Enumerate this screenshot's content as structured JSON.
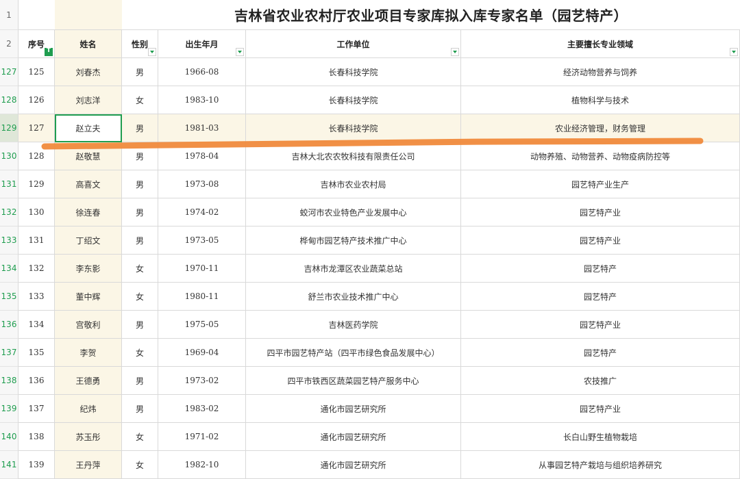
{
  "sheet_title": "吉林省农业农村厅农业项目专家库拟入库专家名单（园艺特产）",
  "row_numbers": {
    "title": "1",
    "header": "2"
  },
  "headers": {
    "seq": "序号",
    "name": "姓名",
    "gender": "性别",
    "birth": "出生年月",
    "employer": "工作单位",
    "expertise": "主要擅长专业领域"
  },
  "filter_active_glyph": "T",
  "rows": [
    {
      "row": "127",
      "seq": "125",
      "name": "刘春杰",
      "gender": "男",
      "birth": "1966-08",
      "employer": "长春科技学院",
      "expertise": "经济动物营养与饲养"
    },
    {
      "row": "128",
      "seq": "126",
      "name": "刘志洋",
      "gender": "女",
      "birth": "1983-10",
      "employer": "长春科技学院",
      "expertise": "植物科学与技术"
    },
    {
      "row": "129",
      "seq": "127",
      "name": "赵立夫",
      "gender": "男",
      "birth": "1981-03",
      "employer": "长春科技学院",
      "expertise": "农业经济管理，财务管理"
    },
    {
      "row": "130",
      "seq": "128",
      "name": "赵敬慧",
      "gender": "男",
      "birth": "1978-04",
      "employer": "吉林大北农农牧科技有限责任公司",
      "expertise": "动物养殖、动物营养、动物疫病防控等"
    },
    {
      "row": "131",
      "seq": "129",
      "name": "高喜文",
      "gender": "男",
      "birth": "1973-08",
      "employer": "吉林市农业农村局",
      "expertise": "园艺特产业生产"
    },
    {
      "row": "132",
      "seq": "130",
      "name": "徐连春",
      "gender": "男",
      "birth": "1974-02",
      "employer": "蛟河市农业特色产业发展中心",
      "expertise": "园艺特产业"
    },
    {
      "row": "133",
      "seq": "131",
      "name": "丁绍文",
      "gender": "男",
      "birth": "1973-05",
      "employer": "桦甸市园艺特产技术推广中心",
      "expertise": "园艺特产业"
    },
    {
      "row": "134",
      "seq": "132",
      "name": "李东影",
      "gender": "女",
      "birth": "1970-11",
      "employer": "吉林市龙潭区农业蔬菜总站",
      "expertise": "园艺特产"
    },
    {
      "row": "135",
      "seq": "133",
      "name": "董中辉",
      "gender": "女",
      "birth": "1980-11",
      "employer": "舒兰市农业技术推广中心",
      "expertise": "园艺特产"
    },
    {
      "row": "136",
      "seq": "134",
      "name": "宫敬利",
      "gender": "男",
      "birth": "1975-05",
      "employer": "吉林医药学院",
      "expertise": "园艺特产业"
    },
    {
      "row": "137",
      "seq": "135",
      "name": "李贺",
      "gender": "女",
      "birth": "1969-04",
      "employer": "四平市园艺特产站（四平市绿色食品发展中心）",
      "expertise": "园艺特产"
    },
    {
      "row": "138",
      "seq": "136",
      "name": "王德勇",
      "gender": "男",
      "birth": "1973-02",
      "employer": "四平市铁西区蔬菜园艺特产服务中心",
      "expertise": "农技推广"
    },
    {
      "row": "139",
      "seq": "137",
      "name": "纪炜",
      "gender": "男",
      "birth": "1983-02",
      "employer": "通化市园艺研究所",
      "expertise": "园艺特产业"
    },
    {
      "row": "140",
      "seq": "138",
      "name": "苏玉彤",
      "gender": "女",
      "birth": "1971-02",
      "employer": "通化市园艺研究所",
      "expertise": "长白山野生植物栽培"
    },
    {
      "row": "141",
      "seq": "139",
      "name": "王丹萍",
      "gender": "女",
      "birth": "1982-10",
      "employer": "通化市园艺研究所",
      "expertise": "从事园艺特产栽培与组织培养研究"
    }
  ],
  "selected_row": "129",
  "selected_column": "name",
  "annotation_color": "#f08a3c",
  "accent_color": "#1f9d4f"
}
